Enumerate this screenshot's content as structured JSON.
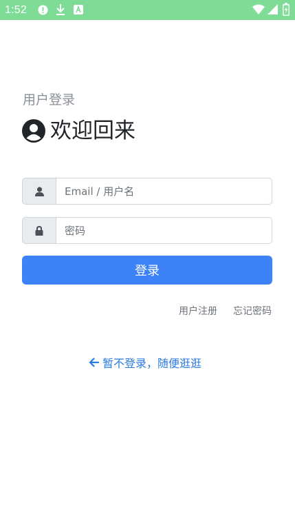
{
  "status_bar": {
    "time": "1:52",
    "left_icons": [
      "alert-circle-icon",
      "download-icon",
      "a-box-icon"
    ],
    "right_icons": [
      "wifi-icon",
      "signal-icon",
      "battery-icon"
    ],
    "background": "#7fdc97"
  },
  "header": {
    "subtitle": "用户登录",
    "title": "欢迎回来",
    "title_icon": "user-circle-icon"
  },
  "form": {
    "username": {
      "placeholder": "Email / 用户名",
      "icon": "user-icon"
    },
    "password": {
      "placeholder": "密码",
      "icon": "lock-icon"
    },
    "login_button": "登录",
    "accent_color": "#3d82f6"
  },
  "links": {
    "register": "用户注册",
    "forgot_password": "忘记密码",
    "skip_login": "暂不登录，随便逛逛",
    "skip_icon": "arrow-left-icon"
  }
}
